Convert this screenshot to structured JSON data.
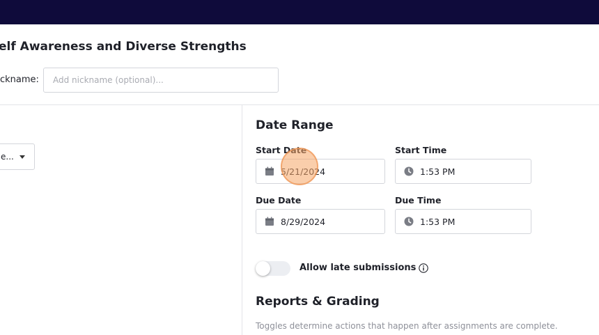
{
  "header": {
    "bar_color": "#0f0b3b"
  },
  "assignment": {
    "title": "elf Awareness and Diverse Strengths",
    "nickname_label": "ckname:",
    "nickname_placeholder": "Add nickname (optional)...",
    "nickname_value": ""
  },
  "left_panel": {
    "select_value": "e..."
  },
  "date_range": {
    "title": "Date Range",
    "start_date_label": "Start Date",
    "start_date_value": "5/21/2024",
    "start_time_label": "Start Time",
    "start_time_value": "1:53 PM",
    "due_date_label": "Due Date",
    "due_date_value": "8/29/2024",
    "due_time_label": "Due Time",
    "due_time_value": "1:53 PM"
  },
  "late_submissions": {
    "label": "Allow late submissions",
    "enabled": false
  },
  "reports": {
    "title": "Reports & Grading",
    "hint": "Toggles determine actions that happen after assignments are complete."
  },
  "icons": {
    "date": "calendar-icon",
    "time": "clock-icon",
    "info": "info-icon",
    "dropdown": "caret-down-icon"
  }
}
